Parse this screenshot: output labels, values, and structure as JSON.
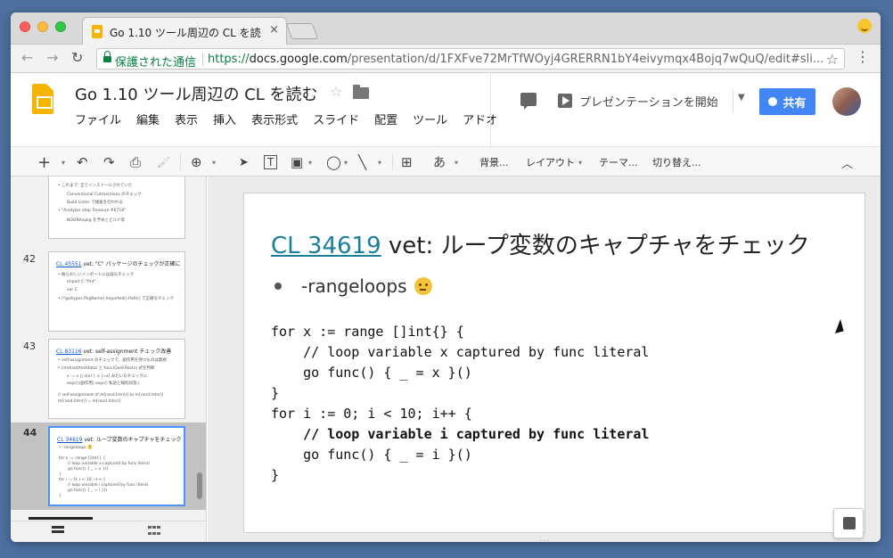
{
  "browser": {
    "tab_title": "Go 1.10 ツール周辺の CL を読む",
    "tab_close": "×",
    "secure_label": "保護された通信",
    "url_scheme": "https://",
    "url_host": "docs.google.com",
    "url_path": "/presentation/d/1FXFve72MrTfWOyj4GRERRN1bY4eivymqx4Bojq7wQuQ/edit#sli...",
    "star": "☆",
    "menu": "⋮",
    "back": "←",
    "forward": "→",
    "reload": "↻"
  },
  "header": {
    "doc_title": "Go 1.10 ツール周辺の CL を読む",
    "title_star": "☆",
    "menus": [
      "ファイル",
      "編集",
      "表示",
      "挿入",
      "表示形式",
      "スライド",
      "配置",
      "ツール",
      "アドオ"
    ],
    "present_label": "プレゼンテーションを開始",
    "present_dropdown": "▼",
    "share_label": "共有"
  },
  "toolbar": {
    "add": "+",
    "undo": "↶",
    "redo": "↷",
    "print": "⎙",
    "paint": "🖌",
    "zoom": "⊕",
    "select": "➤",
    "textbox": "T",
    "image": "▣",
    "shape": "◯",
    "line": "╲",
    "comment": "⊞",
    "input_tool": "あ",
    "background": "背景...",
    "layout": "レイアウト",
    "theme": "テーマ...",
    "transition": "切り替え...",
    "collapse": "︿",
    "caret": "▾"
  },
  "filmstrip": {
    "slides": [
      {
        "number": "",
        "title": "",
        "title_link": "",
        "lines": [
          {
            "text": "• これまで: 全てインストールされていた",
            "sub": false
          },
          {
            "text": "Conventional Cutmentions のチェック",
            "sub": true
          },
          {
            "text": "Build Linter で検査を行われる",
            "sub": true
          },
          {
            "text": "• \"Analyzer step Treasure #6718\"",
            "sub": false
          },
          {
            "text": "NOORAnpkg を予めとビルド等",
            "sub": true
          }
        ]
      },
      {
        "number": "42",
        "title": " vet: \"C\" パッケージのチェックが正確に",
        "title_link": "CL 45551",
        "lines": [
          {
            "text": "• 紛らわしいインポートには誤なチェック",
            "sub": false
          },
          {
            "text": "import C \"fmt\"",
            "sub": true
          },
          {
            "text": "var C",
            "sub": true
          },
          {
            "text": "• (*go/types.PkgName).Imported().Path() で正確なチェック",
            "sub": false
          }
        ]
      },
      {
        "number": "43",
        "title": " vet: self-assignment チェック改善",
        "title_link": "CL 83116",
        "lines": [
          {
            "text": "• self-assignment のチェックで、副作用を持つものは無視",
            "sub": false
          },
          {
            "text": "• cmd/vet/testdata/ と func(Gold.Rects) 式を判断",
            "sub": false
          },
          {
            "text": "x := x  || x(x)    [ .x ]=x]  みたいなチェックに",
            "sub": true
          },
          {
            "text": "expr()(副作用)  expr() 私語と線的同等く",
            "sub": true
          },
          {
            "text": "// self-assignment of m[rand.Intn()] to m[rand.Intn()]",
            "sub": false
          },
          {
            "text": "m[rand.Intn()] = m[rand.Intn()]",
            "sub": false
          }
        ]
      },
      {
        "number": "44",
        "title": " vet: ループ変数のキャプチャをチェック",
        "title_link": "CL 34619",
        "lines": [
          {
            "text": "• -rangeloops 🤔",
            "sub": false
          },
          {
            "text": "for x := range []int{} {",
            "sub": false
          },
          {
            "text": "// loop variable x captured by func literal",
            "sub": true
          },
          {
            "text": "go func() { _ = x }()",
            "sub": true
          },
          {
            "text": "}",
            "sub": false
          },
          {
            "text": "for i := 0; i < 10; i++ {",
            "sub": false
          },
          {
            "text": "// loop variable i captured by func literal",
            "sub": true
          },
          {
            "text": "go func() { _ = i }()",
            "sub": true
          },
          {
            "text": "}",
            "sub": false
          }
        ]
      }
    ]
  },
  "slide": {
    "title_link": "CL 34619",
    "title_rest": " vet: ループ変数のキャプチャをチェック",
    "bullet": "-rangeloops",
    "code_lines": [
      {
        "text": "for x := range []int{} {",
        "bold": false
      },
      {
        "text": "    // loop variable x captured by func literal",
        "bold": false
      },
      {
        "text": "    go func() { _ = x }()",
        "bold": false
      },
      {
        "text": "}",
        "bold": false
      },
      {
        "text": "for i := 0; i < 10; i++ {",
        "bold": false
      },
      {
        "text": "    // loop variable i captured by func literal",
        "bold": true
      },
      {
        "text": "    go func() { _ = i }()",
        "bold": false
      },
      {
        "text": "}",
        "bold": false
      }
    ]
  },
  "colors": {
    "accent": "#4285f4",
    "link": "#1a7f9b",
    "slides_brand": "#f4b400",
    "secure": "#0b8043"
  }
}
